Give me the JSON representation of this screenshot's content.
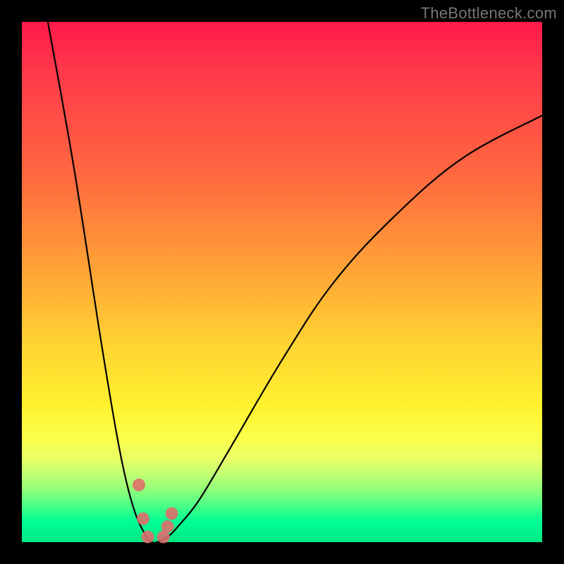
{
  "watermark": "TheBottleneck.com",
  "chart_data": {
    "type": "line",
    "title": "",
    "xlabel": "",
    "ylabel": "",
    "xlim": [
      0,
      100
    ],
    "ylim": [
      0,
      100
    ],
    "series": [
      {
        "name": "bottleneck-curve",
        "x": [
          5,
          10,
          15,
          18,
          20,
          22,
          24,
          25,
          26,
          28,
          30,
          34,
          40,
          50,
          60,
          72,
          85,
          100
        ],
        "values": [
          100,
          72,
          40,
          22,
          12,
          5,
          1,
          0,
          0,
          1,
          3,
          8,
          18,
          35,
          50,
          63,
          74,
          82
        ]
      }
    ],
    "points": [
      {
        "name": "marker-left-upper",
        "x": 22.5,
        "y": 11
      },
      {
        "name": "marker-left-lower",
        "x": 23.3,
        "y": 4.5
      },
      {
        "name": "marker-min-left",
        "x": 24.2,
        "y": 1
      },
      {
        "name": "marker-min-right",
        "x": 27.2,
        "y": 1
      },
      {
        "name": "marker-right-lower",
        "x": 28.0,
        "y": 3
      },
      {
        "name": "marker-right-upper",
        "x": 28.8,
        "y": 5.5
      }
    ],
    "marker_radius_px": 9
  }
}
